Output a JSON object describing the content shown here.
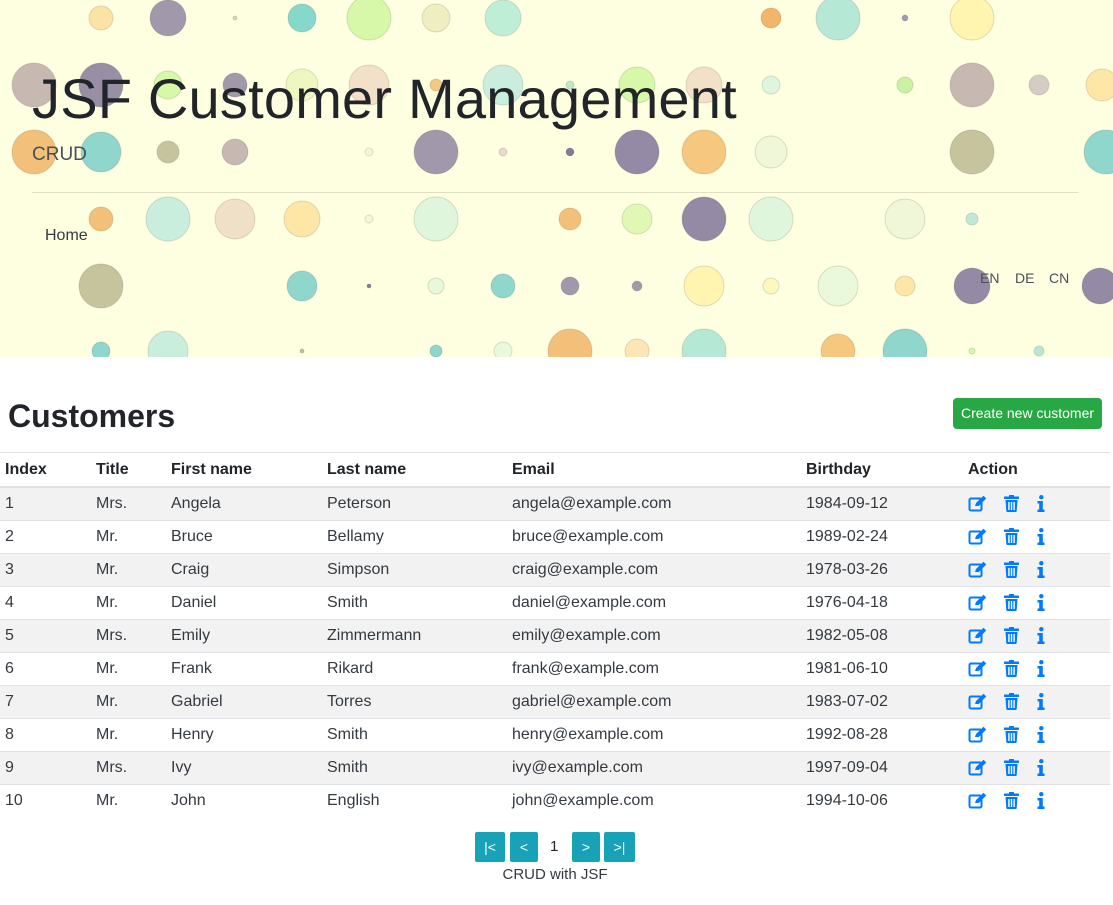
{
  "header": {
    "title": "JSF Customer Management",
    "subtitle": "CRUD",
    "nav": {
      "home": "Home"
    },
    "languages": [
      "EN",
      "DE",
      "CN"
    ]
  },
  "main": {
    "heading": "Customers",
    "create_button": "Create new customer",
    "columns": [
      "Index",
      "Title",
      "First name",
      "Last name",
      "Email",
      "Birthday",
      "Action"
    ],
    "rows": [
      [
        "1",
        "Mrs.",
        "Angela",
        "Peterson",
        "angela@example.com",
        "1984-09-12"
      ],
      [
        "2",
        "Mr.",
        "Bruce",
        "Bellamy",
        "bruce@example.com",
        "1989-02-24"
      ],
      [
        "3",
        "Mr.",
        "Craig",
        "Simpson",
        "craig@example.com",
        "1978-03-26"
      ],
      [
        "4",
        "Mr.",
        "Daniel",
        "Smith",
        "daniel@example.com",
        "1976-04-18"
      ],
      [
        "5",
        "Mrs.",
        "Emily",
        "Zimmermann",
        "emily@example.com",
        "1982-05-08"
      ],
      [
        "6",
        "Mr.",
        "Frank",
        "Rikard",
        "frank@example.com",
        "1981-06-10"
      ],
      [
        "7",
        "Mr.",
        "Gabriel",
        "Torres",
        "gabriel@example.com",
        "1983-07-02"
      ],
      [
        "8",
        "Mr.",
        "Henry",
        "Smith",
        "henry@example.com",
        "1992-08-28"
      ],
      [
        "9",
        "Mrs.",
        "Ivy",
        "Smith",
        "ivy@example.com",
        "1997-09-04"
      ],
      [
        "10",
        "Mr.",
        "John",
        "English",
        "john@example.com",
        "1994-10-06"
      ]
    ],
    "row_actions": [
      "edit-icon",
      "trash-icon",
      "info-icon"
    ]
  },
  "pagination": {
    "first": "|<",
    "prev": "<",
    "current_page": "1",
    "next": ">",
    "last": ">|"
  },
  "footer": {
    "text": "CRUD with JSF"
  },
  "colors": {
    "hero_background": "#fefee0",
    "create_button": "#28a745",
    "pager_button": "#17a2b8",
    "action_icon": "#007bff",
    "striped_row": "#f2f2f2"
  }
}
